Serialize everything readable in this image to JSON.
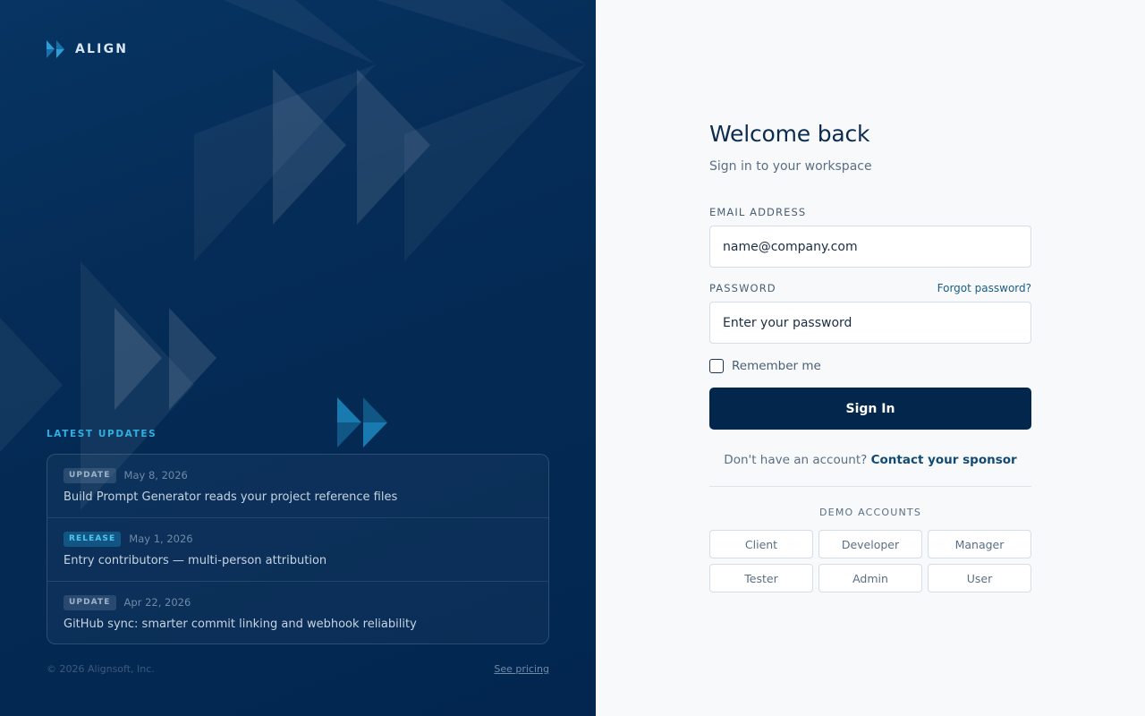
{
  "brand": {
    "name": "ALIGN",
    "logo_icon": "double-chevron-right-icon"
  },
  "updates": {
    "label": "LATEST UPDATES",
    "items": [
      {
        "tag": "UPDATE",
        "date": "May 8, 2026",
        "title": "Build Prompt Generator reads your project reference files"
      },
      {
        "tag": "RELEASE",
        "date": "May 1, 2026",
        "title": "Entry contributors — multi-person attribution"
      },
      {
        "tag": "UPDATE",
        "date": "Apr 22, 2026",
        "title": "GitHub sync: smarter commit linking and webhook reliability"
      }
    ]
  },
  "footer": {
    "copyright": "© 2026 Alignsoft, Inc.",
    "pricing_link": "See pricing"
  },
  "login": {
    "title": "Welcome back",
    "subtitle": "Sign in to your workspace",
    "email_label": "EMAIL ADDRESS",
    "email_placeholder": "name@company.com",
    "password_label": "PASSWORD",
    "forgot_link": "Forgot password?",
    "password_placeholder": "Enter your password",
    "remember_label": "Remember me",
    "remember_checked": false,
    "signin_label": "Sign In",
    "no_account_text": "Don't have an account?",
    "contact_link": "Contact your sponsor"
  },
  "demo": {
    "label": "DEMO ACCOUNTS",
    "accounts": [
      "Client",
      "Developer",
      "Manager",
      "Tester",
      "Admin",
      "User"
    ]
  },
  "colors": {
    "panel_dark": "#022650",
    "accent_cyan": "#2fb0e0",
    "primary_button": "#02264c",
    "link": "#134a73"
  }
}
